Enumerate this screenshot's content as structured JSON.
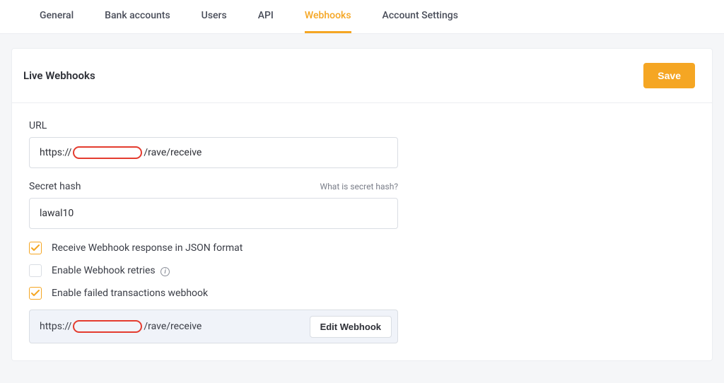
{
  "tabs": [
    {
      "label": "General",
      "active": false
    },
    {
      "label": "Bank accounts",
      "active": false
    },
    {
      "label": "Users",
      "active": false
    },
    {
      "label": "API",
      "active": false
    },
    {
      "label": "Webhooks",
      "active": true
    },
    {
      "label": "Account Settings",
      "active": false
    }
  ],
  "panel": {
    "title": "Live Webhooks",
    "save_label": "Save"
  },
  "url": {
    "label": "URL",
    "prefix": "https://",
    "suffix": "/rave/receive"
  },
  "secret": {
    "label": "Secret hash",
    "hint": "What is secret hash?",
    "value": "lawal10"
  },
  "checks": {
    "json": {
      "label": "Receive Webhook response in JSON format",
      "checked": true
    },
    "retries": {
      "label": "Enable Webhook retries",
      "checked": false
    },
    "failed": {
      "label": "Enable failed transactions webhook",
      "checked": true
    }
  },
  "failed_url": {
    "prefix": "https://",
    "suffix": "/rave/receive",
    "edit_label": "Edit Webhook"
  }
}
